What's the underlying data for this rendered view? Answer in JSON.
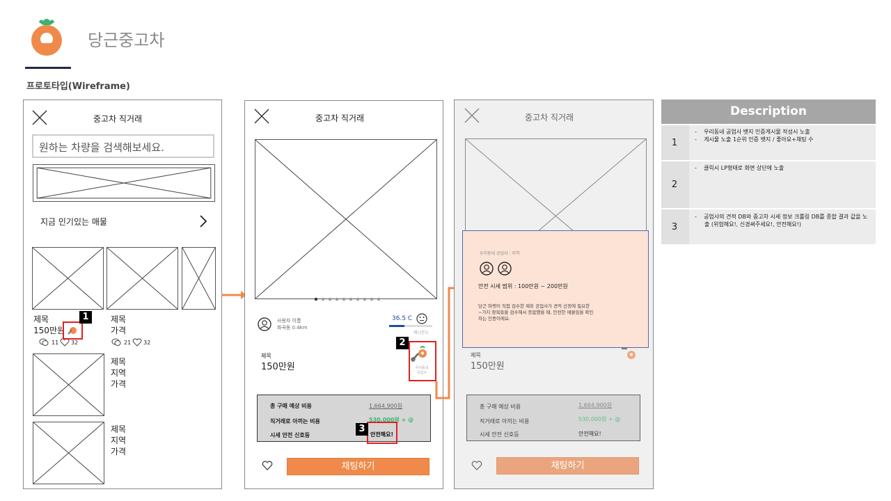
{
  "header": {
    "brand_name": "당근중고차",
    "subtitle": "프로토타입(Wireframe)"
  },
  "colors": {
    "brand_orange": "#f08a4a",
    "marker_red": "#e02020",
    "popup_bg": "#fde3d6",
    "saving_green": "#3cb371",
    "description_header": "#a6a6a6"
  },
  "screen1": {
    "title": "중고차 직거래",
    "search_placeholder": "원하는 차량을 검색해보세요.",
    "section_label": "지금 인기있는 매물",
    "cards": [
      {
        "title": "제목",
        "price": "150만원",
        "comments": "11",
        "likes": "32"
      },
      {
        "title": "제목",
        "price": "가격",
        "comments": "21",
        "likes": "32"
      }
    ],
    "list_items": [
      {
        "title": "제목",
        "region": "지역",
        "price": "가격"
      },
      {
        "title": "제목",
        "region": "지역",
        "price": "가격"
      }
    ]
  },
  "screen2": {
    "title": "중고차 직거래",
    "seller_name": "사용자 이름",
    "seller_location": "화곡동 0.4km",
    "temperature": "36.5 C",
    "temperature_level": 0.36,
    "temp_label": "매너온도",
    "item_label": "제목",
    "item_price": "150만원",
    "badge_caption_1": "우리동네",
    "badge_caption_2": "공업사",
    "cost_labels": [
      "총 구매 예상 비용",
      "직거래로 아끼는 비용",
      "시세 안전 신호등"
    ],
    "cost_values": [
      "1,664,900원",
      "530,000원 + @",
      "안전해요!"
    ],
    "like_icon": "heart-icon",
    "chat_button": "채팅하기"
  },
  "screen3": {
    "title": "중고차 직거래",
    "popup_label": "우리동네 공업사 : 지역",
    "popup_range": "안전 시세 범위 : 100만원  ~ 200만원",
    "popup_desc_1": "당근 마켓이 직접 검수한 제휴 공업사가 견적 산정에 필요한",
    "popup_desc_2": "~가지 항목들을 검수해서 종합했을 때, 안전한 매물임을 확인",
    "popup_desc_3": "하는 인증이에요.",
    "item_label": "제목",
    "item_price": "150만원",
    "cost_labels": [
      "총 구매 예상 비용",
      "직거래로 아끼는 비용",
      "시세 안전 신호등"
    ],
    "cost_values": [
      "1,664,900원",
      "530,000원 + @",
      "안전해요!"
    ],
    "chat_button": "채팅하기"
  },
  "markers": [
    "1",
    "2",
    "3"
  ],
  "description": {
    "title": "Description",
    "rows": [
      {
        "num": "1",
        "lines": [
          "우리동네 공업사 뱃지 인증게시물 작성시 노출",
          "게시물 노출 1순위 인증 뱃지 / 좋아요+채팅  수"
        ]
      },
      {
        "num": "2",
        "lines": [
          "클릭시 LP형태로 화면 상단에 노출"
        ]
      },
      {
        "num": "3",
        "lines": [
          "공업사의 견적 DB와 중고차 시세 정보 크롤링 DB를 종합 결과 값을 노출 (위험해요!, 신경써주세요!, 안전해요!)"
        ]
      }
    ]
  }
}
